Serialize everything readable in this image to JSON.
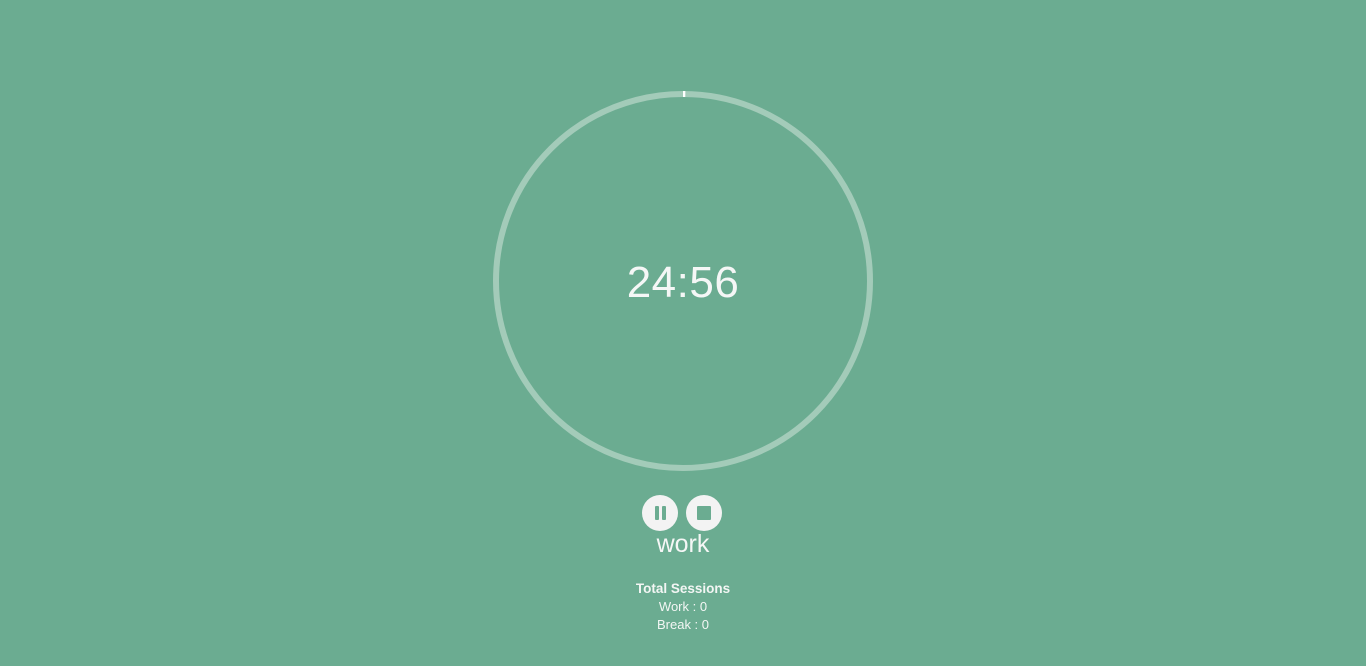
{
  "timer": {
    "time": "24:56",
    "progress_fraction": 0.002,
    "mode": "work"
  },
  "controls": {
    "pause_icon": "pause-icon",
    "stop_icon": "stop-icon"
  },
  "sessions": {
    "title": "Total Sessions",
    "work": "Work : 0",
    "break": "Break : 0"
  },
  "colors": {
    "background": "#6bac91",
    "ring_track": "#a3cbb9",
    "ring_progress": "#ffffff",
    "button": "#f3f3f3"
  }
}
